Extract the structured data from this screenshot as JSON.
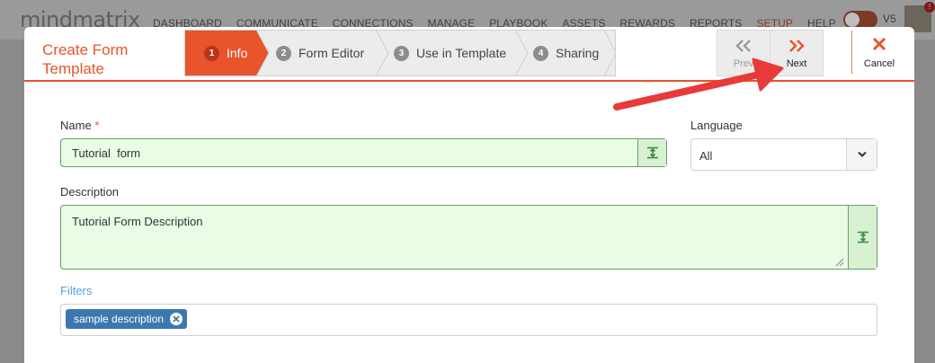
{
  "app": {
    "logo": "mindmatrix",
    "nav": [
      "DASHBOARD",
      "COMMUNICATE",
      "CONNECTIONS",
      "MANAGE",
      "PLAYBOOK",
      "ASSETS",
      "REWARDS",
      "REPORTS",
      "SETUP",
      "HELP"
    ],
    "active_nav": "SETUP",
    "version": "V5",
    "notification_badge": "!"
  },
  "modal": {
    "title": "Create Form Template",
    "steps": [
      {
        "num": "1",
        "label": "Info"
      },
      {
        "num": "2",
        "label": "Form Editor"
      },
      {
        "num": "3",
        "label": "Use in Template"
      },
      {
        "num": "4",
        "label": "Sharing"
      }
    ],
    "active_step": 1,
    "prev_label": "Prev",
    "next_label": "Next",
    "cancel_label": "Cancel"
  },
  "form": {
    "name_label": "Name",
    "name_required": "*",
    "name_value": "Tutorial  form",
    "language_label": "Language",
    "language_value": "All",
    "description_label": "Description",
    "description_value": "Tutorial Form Description",
    "filters_label": "Filters",
    "filter_tags": [
      "sample description"
    ]
  },
  "colors": {
    "accent": "#e8542b",
    "valid_field_bg": "#eafbe6",
    "valid_field_border": "#66a066",
    "tag_bg": "#3c78b0",
    "annotation_arrow": "#e83a3a"
  }
}
